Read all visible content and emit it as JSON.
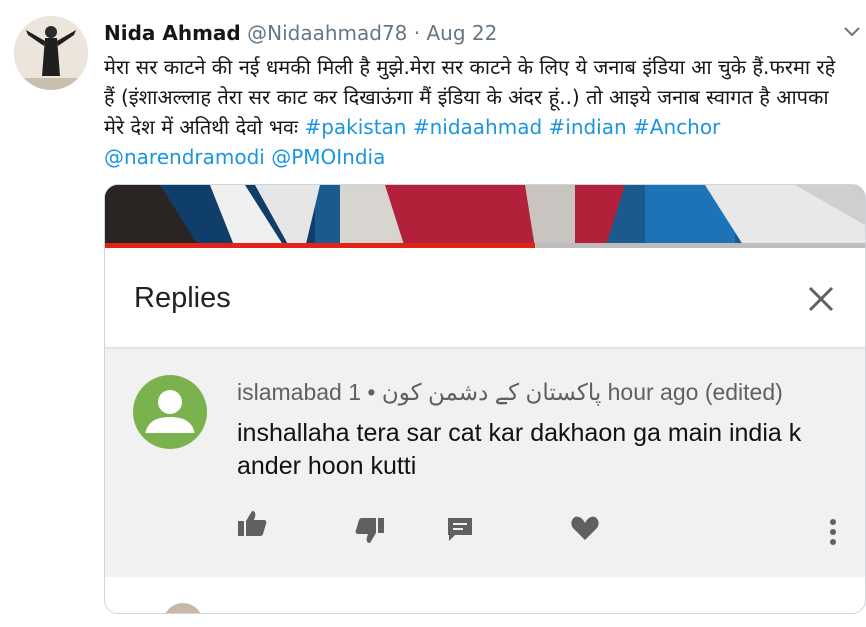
{
  "tweet": {
    "author_name": "Nida Ahmad",
    "handle": "@Nidaahmad78",
    "date_separator": " · ",
    "date": "Aug 22",
    "text_part1": "मेरा सर काटने की नई धमकी मिली है मुझे.मेरा सर काटने के लिए ये जनाब इंडिया आ चुके हैं.फरमा रहे हैं (इंशाअल्लाह तेरा सर काट कर दिखाऊंगा मैं इंडिया के अंदर हूं..) तो आइये जनाब स्वागत है आपका मेरे देश में अतिथी देवो भवः ",
    "hashtags_line": "#pakistan #nidaahmad #indian #Anchor",
    "mention1": "@narendramodi",
    "mention2": "@PMOIndia"
  },
  "replies_panel": {
    "title": "Replies",
    "close_icon": "close-icon"
  },
  "comment": {
    "author": "islamabad پاکستان کے دشمن کون",
    "bullet": " • ",
    "time": "1 hour ago (edited)",
    "text": "inshallaha tera sar cat kar dakhaon ga main india k ander hoon kutti",
    "actions": [
      "thumbs-up-icon",
      "thumbs-down-icon",
      "reply-icon",
      "heart-icon",
      "more-vert-icon"
    ]
  },
  "colors": {
    "link": "#1b95e0",
    "meta_gray": "#657786",
    "comment_bg": "#f1f1f1",
    "avatar_green": "#7ab34d",
    "progress_red": "#e2231a"
  }
}
